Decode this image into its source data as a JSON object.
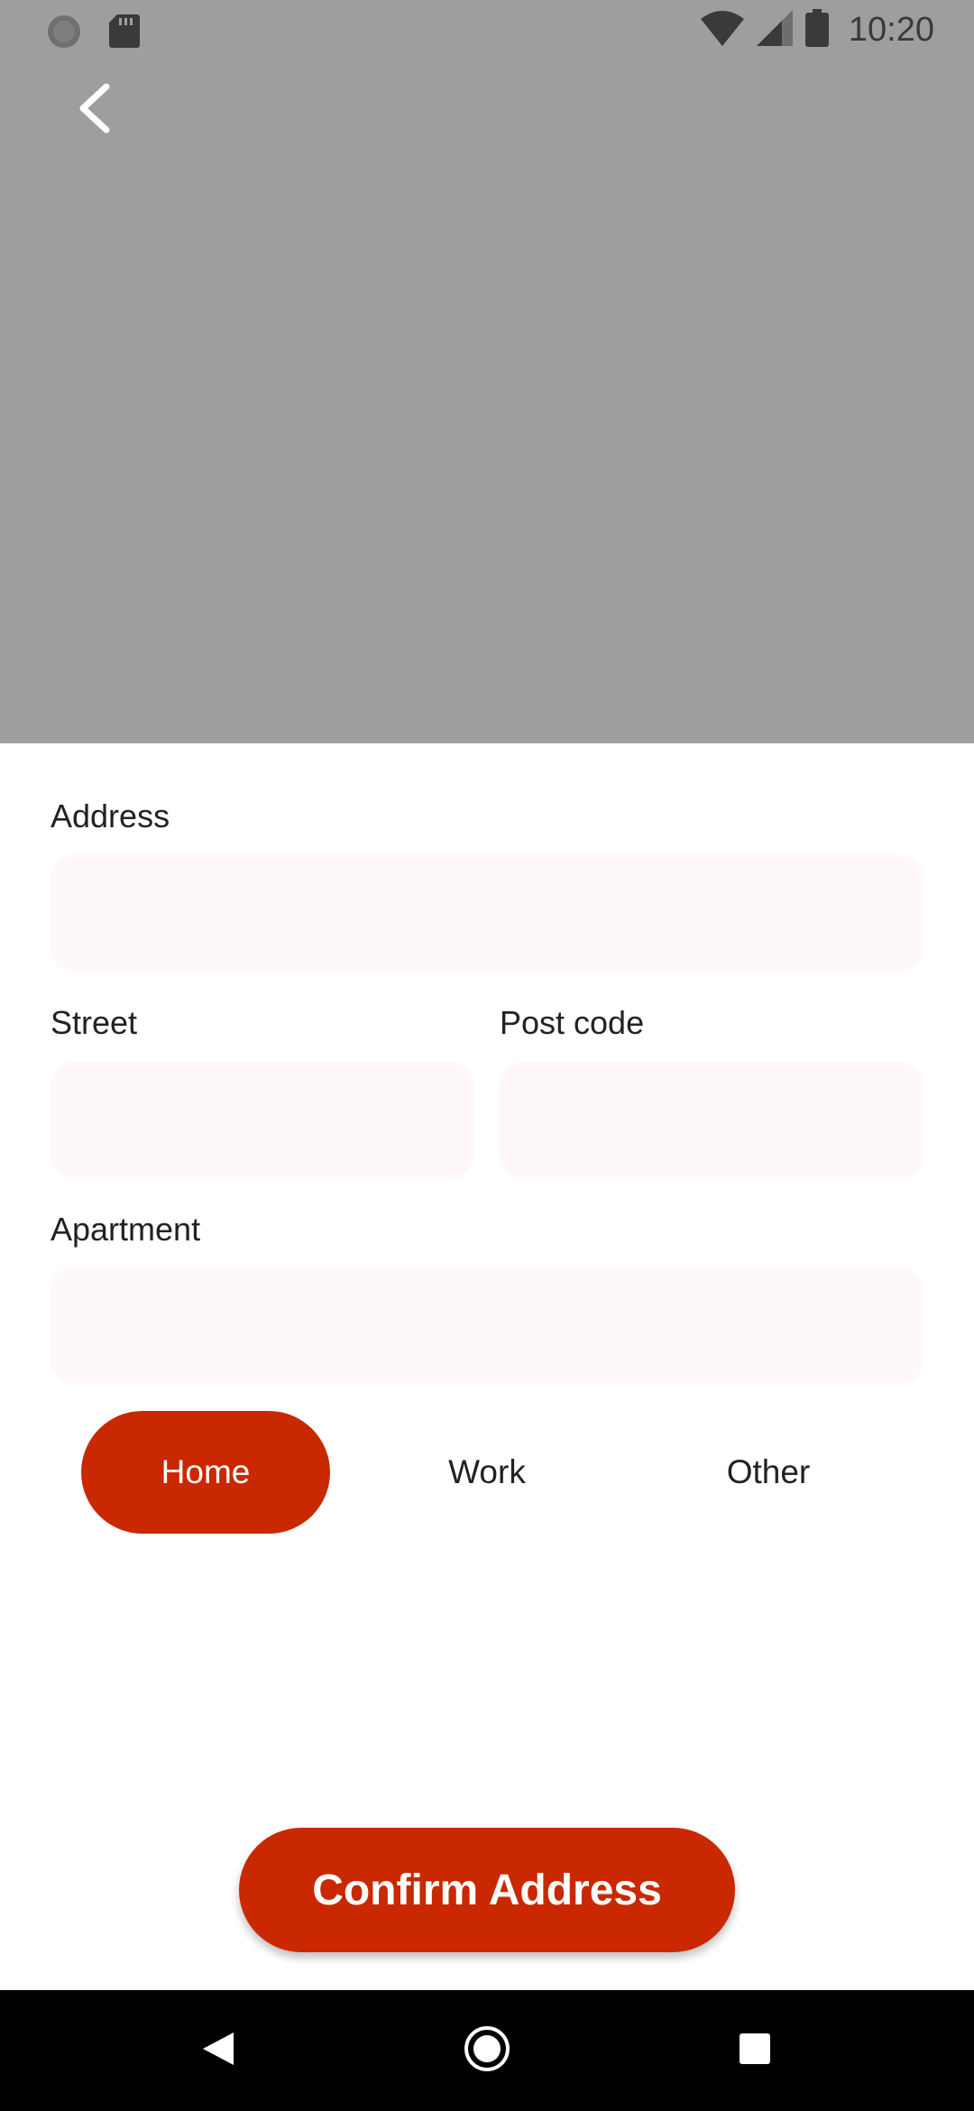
{
  "status_bar": {
    "time": "10:20",
    "icons": [
      "loading-indicator-icon",
      "sd-card-icon",
      "wifi-icon",
      "cellular-signal-icon",
      "battery-icon"
    ]
  },
  "header": {
    "back_icon": "chevron-left-icon"
  },
  "form": {
    "address": {
      "label": "Address",
      "value": "",
      "placeholder": ""
    },
    "street": {
      "label": "Street",
      "value": "",
      "placeholder": ""
    },
    "post_code": {
      "label": "Post code",
      "value": "",
      "placeholder": ""
    },
    "apartment": {
      "label": "Apartment",
      "value": "",
      "placeholder": ""
    }
  },
  "address_types": {
    "selected": "Home",
    "options": [
      {
        "label": "Home"
      },
      {
        "label": "Work"
      },
      {
        "label": "Other"
      }
    ]
  },
  "confirm_button": {
    "label": "Confirm Address"
  },
  "nav_bar": {
    "icons": [
      "back-triangle-icon",
      "home-circle-icon",
      "recents-square-icon"
    ]
  },
  "colors": {
    "accent": "#c92800",
    "map_placeholder": "#9e9e9e",
    "input_background": "#fff8f8",
    "nav_bar": "#000000"
  }
}
